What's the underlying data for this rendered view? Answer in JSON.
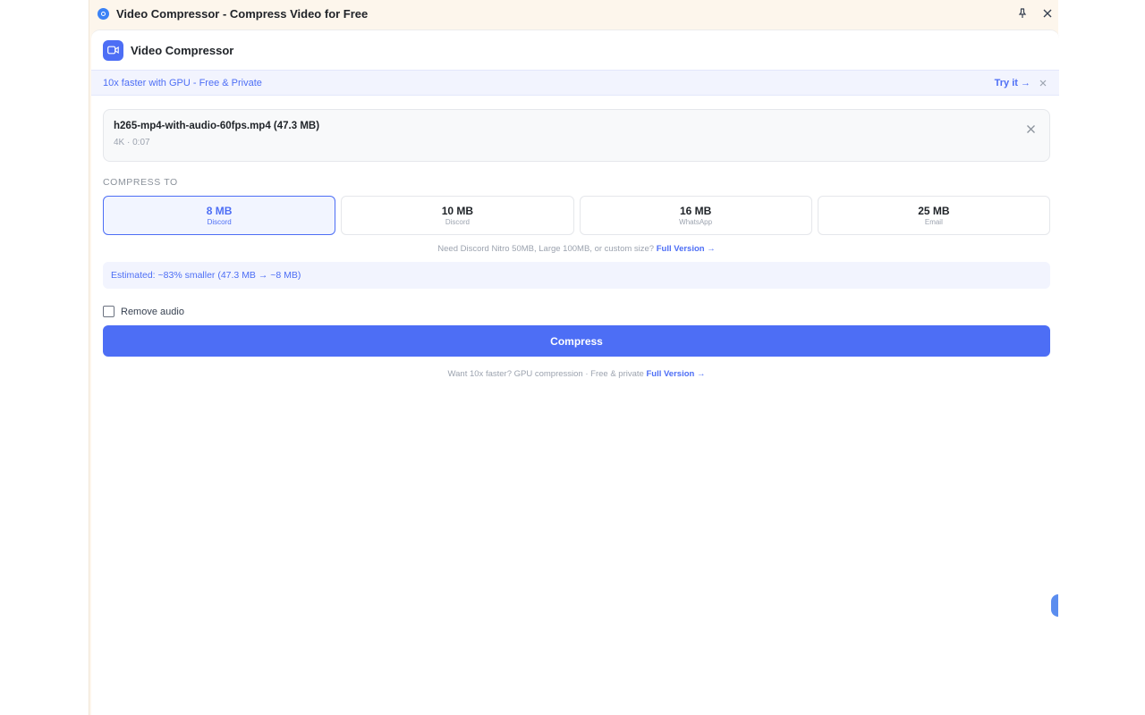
{
  "window": {
    "title": "Video Compressor - Compress Video for Free",
    "pin_icon": "pin-icon",
    "close_icon": "close-icon"
  },
  "app": {
    "name": "Video Compressor",
    "logo_icon": "video-camera-icon",
    "accent": "#4d6ef5"
  },
  "banner": {
    "text": "10x faster with GPU - Free & Private",
    "link": "Try it →"
  },
  "file": {
    "name": "h265-mp4-with-audio-60fps.mp4 (47.3 MB)",
    "meta": "4K · 0:07"
  },
  "compress": {
    "label": "COMPRESS TO",
    "options": [
      {
        "size": "8 MB",
        "target": "Discord",
        "selected": true
      },
      {
        "size": "10 MB",
        "target": "Discord",
        "selected": false
      },
      {
        "size": "16 MB",
        "target": "WhatsApp",
        "selected": false
      },
      {
        "size": "25 MB",
        "target": "Email",
        "selected": false
      }
    ],
    "hint_text": "Need Discord Nitro 50MB, Large 100MB, or custom size?",
    "hint_link": "Full Version →"
  },
  "estimate": "Estimated: ~83% smaller (47.3 MB → ~8 MB)",
  "remove_audio": {
    "label": "Remove audio",
    "checked": false
  },
  "compress_button": "Compress",
  "footer": {
    "text": "Want 10x faster? GPU compression · Free & private",
    "link": "Full Version →"
  }
}
